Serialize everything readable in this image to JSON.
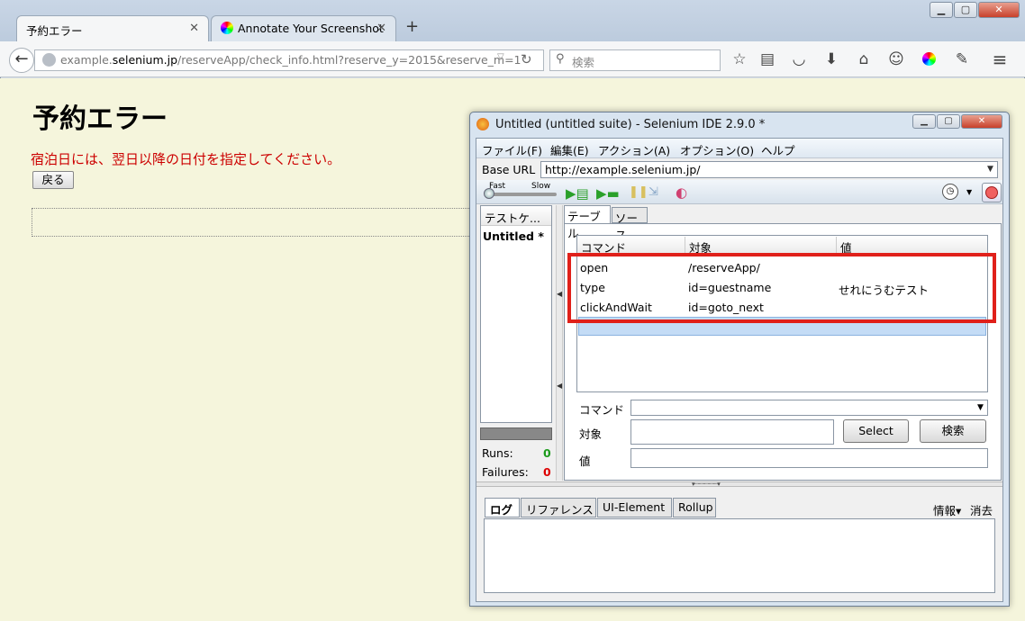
{
  "browser": {
    "tabs": [
      {
        "label": "予約エラー",
        "active": true
      },
      {
        "label": "Annotate Your Screenshot",
        "active": false
      }
    ],
    "url_prefix": "example.",
    "url_domain": "selenium.jp",
    "url_rest": "/reserveApp/check_info.html?reserve_y=2015&reserve_m=1",
    "search_placeholder": "検索",
    "icons": [
      "search-icon",
      "star-icon",
      "reader-icon",
      "pocket-icon",
      "download-icon",
      "home-icon",
      "chat-icon",
      "color-icon",
      "screenshot-icon",
      "menu-icon"
    ]
  },
  "page": {
    "title": "予約エラー",
    "error": "宿泊日には、翌日以降の日付を指定してください。",
    "back_button": "戻る"
  },
  "ide": {
    "title": "Untitled (untitled suite) - Selenium IDE 2.9.0 *",
    "menu": [
      "ファイル(F)",
      "編集(E)",
      "アクション(A)",
      "オプション(O)",
      "ヘルプ"
    ],
    "base_url_label": "Base URL",
    "base_url": "http://example.selenium.jp/",
    "speed_fast": "Fast",
    "speed_slow": "Slow",
    "suite_header": "テストケ...",
    "suite_item": "Untitled *",
    "runs_label": "Runs:",
    "runs": "0",
    "failures_label": "Failures:",
    "failures": "0",
    "tab_table": "テーブル",
    "tab_source": "ソース",
    "columns": [
      "コマンド",
      "対象",
      "値"
    ],
    "rows": [
      {
        "command": "open",
        "target": "/reserveApp/",
        "value": ""
      },
      {
        "command": "type",
        "target": "id=guestname",
        "value": "せれにうむテスト"
      },
      {
        "command": "clickAndWait",
        "target": "id=goto_next",
        "value": ""
      }
    ],
    "cmd_label": "コマンド",
    "target_label": "対象",
    "value_label": "値",
    "select_button": "Select",
    "find_button": "検索",
    "log_tabs": [
      "ログ",
      "リファレンス",
      "UI-Element",
      "Rollup"
    ],
    "log_info": "情報▾",
    "log_clear": "消去"
  }
}
